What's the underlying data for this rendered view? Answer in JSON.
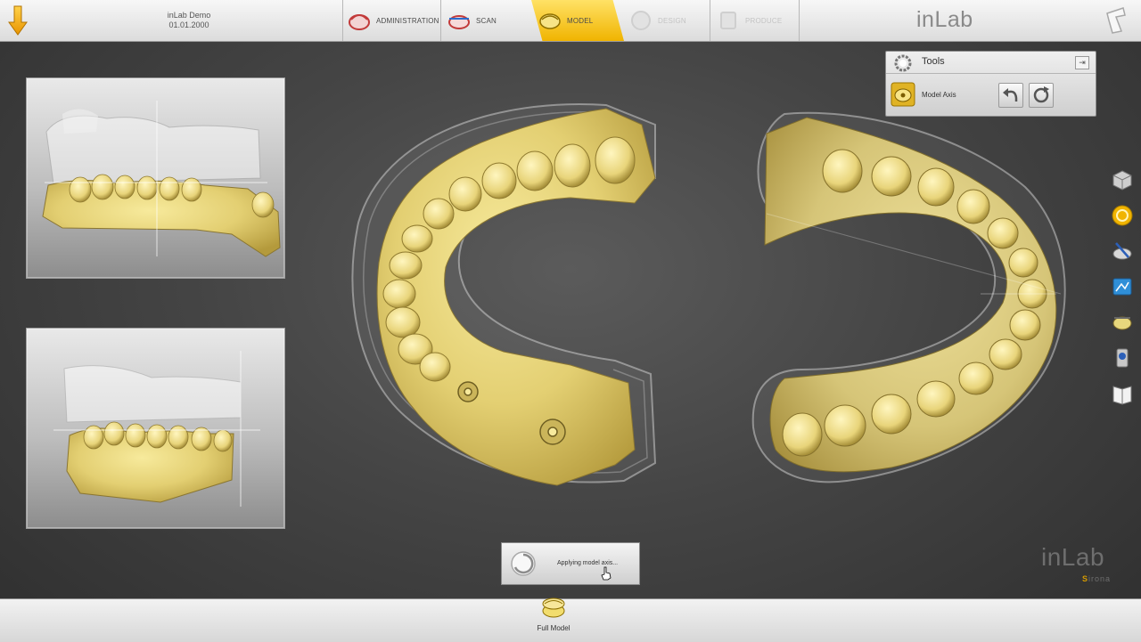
{
  "header": {
    "case_name": "inLab Demo",
    "case_date": "01.01.2000",
    "brand": "inLab",
    "phases": [
      {
        "label": "ADMINISTRATION",
        "state": "normal"
      },
      {
        "label": "SCAN",
        "state": "normal"
      },
      {
        "label": "MODEL",
        "state": "active"
      },
      {
        "label": "DESIGN",
        "state": "disabled"
      },
      {
        "label": "PRODUCE",
        "state": "disabled"
      }
    ]
  },
  "tools_panel": {
    "title": "Tools",
    "item_label": "Model Axis",
    "icons": [
      "model-axis-icon",
      "undo-icon",
      "rotate-icon"
    ]
  },
  "right_toolbar": {
    "icons": [
      "cube-view-icon",
      "model-axis-icon",
      "trim-icon",
      "view-icon",
      "occlusion-icon",
      "analysis-icon",
      "catalog-icon"
    ]
  },
  "progress": {
    "text": "Applying model axis..."
  },
  "watermark": {
    "brand": "inLab",
    "sub_prefix": "S",
    "sub_rest": "irona"
  },
  "footer": {
    "item_label": "Full Model"
  },
  "colors": {
    "accent": "#f0b400",
    "model": "#e6d27a",
    "background": "#4a4a4a"
  }
}
